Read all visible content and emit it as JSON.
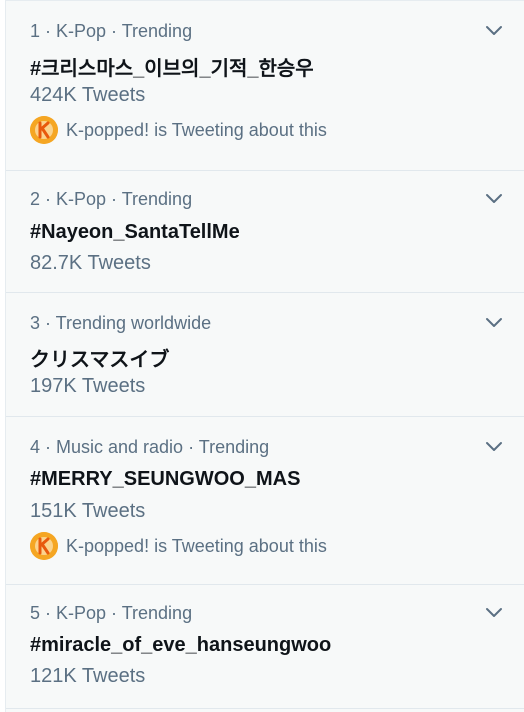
{
  "colors": {
    "background": "#f7f9f9",
    "primary_text": "#0f1419",
    "secondary_text": "#5b7083",
    "divider": "#e1e8ed",
    "avatar_orange": "#f5a623"
  },
  "trends": [
    {
      "meta": "1 · K-Pop · Trending",
      "name": "#크리스마스_이브의_기적_한승우",
      "count": "424K Tweets",
      "context": "K-popped! is Tweeting about this"
    },
    {
      "meta": "2 · K-Pop · Trending",
      "name": "#Nayeon_SantaTellMe",
      "count": "82.7K Tweets"
    },
    {
      "meta": "3 · Trending worldwide",
      "name": "クリスマスイブ",
      "count": "197K Tweets"
    },
    {
      "meta": "4 · Music and radio · Trending",
      "name": "#MERRY_SEUNGWOO_MAS",
      "count": "151K Tweets",
      "context": "K-popped! is Tweeting about this"
    },
    {
      "meta": "5 · K-Pop · Trending",
      "name": "#miracle_of_eve_hanseungwoo",
      "count": "121K Tweets"
    }
  ],
  "icons": {
    "more": "chevron-down-icon",
    "context_avatar": "k-popped-avatar"
  }
}
